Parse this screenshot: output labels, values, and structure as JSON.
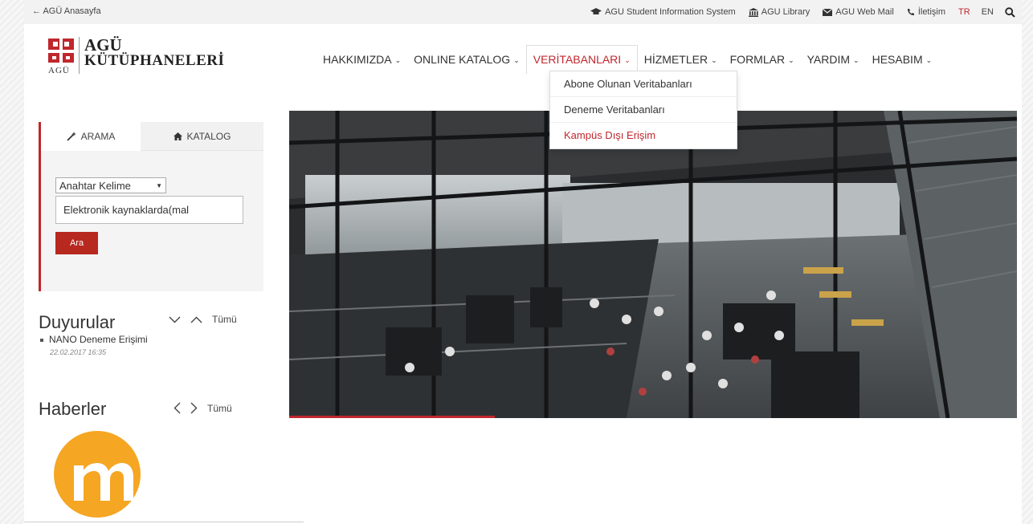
{
  "topbar": {
    "home_label": "AGÜ Anasayfa",
    "links": [
      {
        "icon": "graduation-cap-icon",
        "label": "AGU Student Information System"
      },
      {
        "icon": "library-icon",
        "label": "AGU Library"
      },
      {
        "icon": "envelope-icon",
        "label": "AGU Web Mail"
      },
      {
        "icon": "phone-icon",
        "label": "İletişim"
      }
    ],
    "lang_tr": "TR",
    "lang_en": "EN"
  },
  "logo": {
    "line1": "AGÜ",
    "line2": "KÜTÜPHANELERİ",
    "sub": "AGÜ"
  },
  "nav": [
    {
      "label": "HAKKIMIZDA",
      "active": false
    },
    {
      "label": "ONLINE KATALOG",
      "active": false
    },
    {
      "label": "VERİTABANLARI",
      "active": true
    },
    {
      "label": "HİZMETLER",
      "active": false
    },
    {
      "label": "FORMLAR",
      "active": false
    },
    {
      "label": "YARDIM",
      "active": false
    },
    {
      "label": "HESABIM",
      "active": false
    }
  ],
  "dropdown": [
    "Abone Olunan Veritabanları",
    "Deneme Veritabanları",
    "Kampüs Dışı Erişim"
  ],
  "search": {
    "tab1": "ARAMA",
    "tab2": "KATALOG",
    "select_value": "Anahtar Kelime",
    "input_value": "Elektronik kaynaklarda(mal",
    "button": "Ara"
  },
  "announcements": {
    "title": "Duyurular",
    "all": "Tümü",
    "item": "NANO Deneme Erişimi",
    "date": "22.02.2017 16:35"
  },
  "news": {
    "title": "Haberler",
    "all": "Tümü"
  },
  "colors": {
    "accent": "#c0272d",
    "logo_orange": "#f5a623"
  }
}
